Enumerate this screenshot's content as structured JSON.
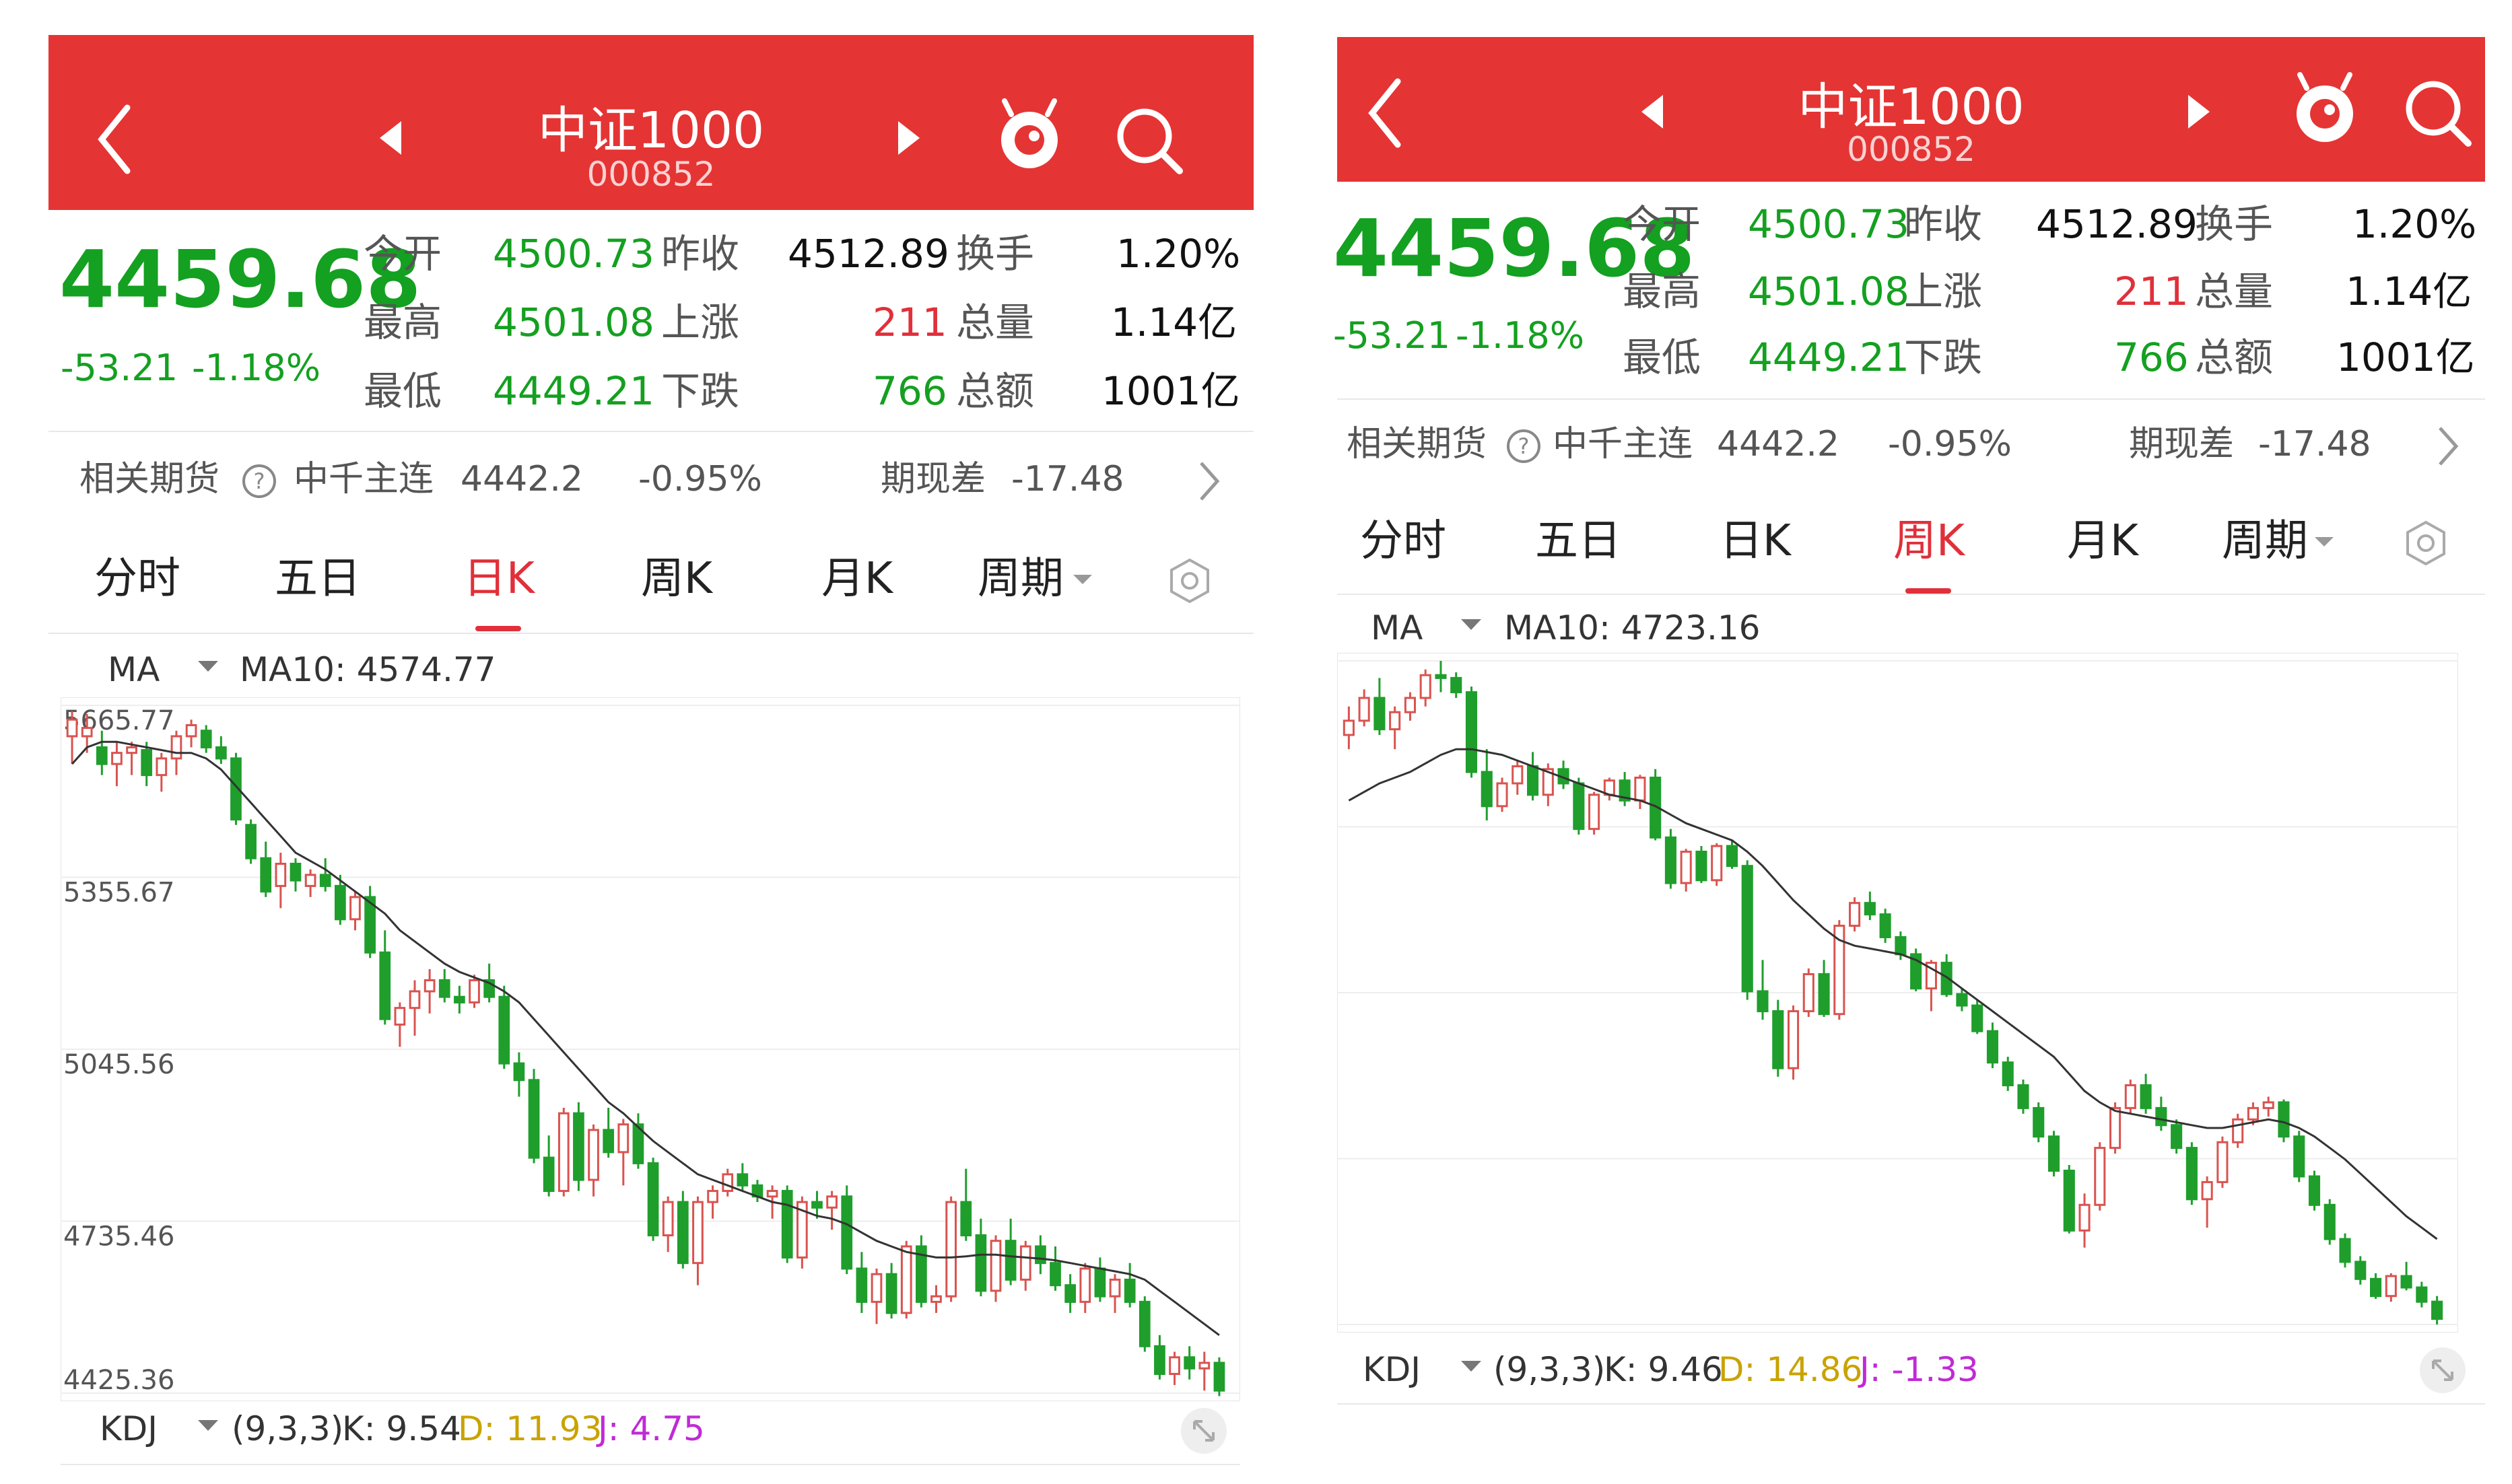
{
  "panels": [
    {
      "header": {
        "title": "中证1000",
        "code": "000852"
      },
      "quote": {
        "price": "4459.68",
        "change": "-53.21",
        "change_pct": "-1.18%",
        "open_label": "今开",
        "open": "4500.73",
        "prev_close_label": "昨收",
        "prev_close": "4512.89",
        "turnover_label": "换手",
        "turnover": "1.20%",
        "high_label": "最高",
        "high": "4501.08",
        "up_label": "上涨",
        "up": "211",
        "volume_label": "总量",
        "volume": "1.14亿",
        "low_label": "最低",
        "low": "4449.21",
        "down_label": "下跌",
        "down": "766",
        "amount_label": "总额",
        "amount": "1001亿"
      },
      "futures": {
        "label": "相关期货",
        "contract": "中千主连",
        "price": "4442.2",
        "pct": "-0.95%",
        "basis_label": "期现差",
        "basis": "-17.48"
      },
      "tabs": [
        "分时",
        "五日",
        "日K",
        "周K",
        "月K",
        "周期"
      ],
      "active_tab": 2,
      "ma": {
        "label": "MA",
        "value": "MA10: 4574.77"
      },
      "kdj": {
        "label": "KDJ",
        "params": "(9,3,3)",
        "k": "K: 9.54",
        "d": "D: 11.93",
        "j": "J: 4.75"
      }
    },
    {
      "header": {
        "title": "中证1000",
        "code": "000852"
      },
      "quote": {
        "price": "4459.68",
        "change": "-53.21",
        "change_pct": "-1.18%",
        "open_label": "今开",
        "open": "4500.73",
        "prev_close_label": "昨收",
        "prev_close": "4512.89",
        "turnover_label": "换手",
        "turnover": "1.20%",
        "high_label": "最高",
        "high": "4501.08",
        "up_label": "上涨",
        "up": "211",
        "volume_label": "总量",
        "volume": "1.14亿",
        "low_label": "最低",
        "low": "4449.21",
        "down_label": "下跌",
        "down": "766",
        "amount_label": "总额",
        "amount": "1001亿"
      },
      "futures": {
        "label": "相关期货",
        "contract": "中千主连",
        "price": "4442.2",
        "pct": "-0.95%",
        "basis_label": "期现差",
        "basis": "-17.48"
      },
      "tabs": [
        "分时",
        "五日",
        "日K",
        "周K",
        "月K",
        "周期"
      ],
      "active_tab": 3,
      "ma": {
        "label": "MA",
        "value": "MA10: 4723.16"
      },
      "kdj": {
        "label": "KDJ",
        "params": "(9,3,3)",
        "k": "K: 9.46",
        "d": "D: 14.86",
        "j": "J: -1.33"
      }
    }
  ],
  "chart_data": [
    {
      "type": "candlestick",
      "period": "日K",
      "y_tick_labels": [
        "5665.77",
        "5355.67",
        "5045.56",
        "4735.46",
        "4425.36"
      ],
      "ylim": [
        4425.36,
        5665.77
      ],
      "series": [
        {
          "name": "MA10",
          "type": "line"
        }
      ],
      "candles": [
        [
          5610,
          5655,
          5560,
          5640
        ],
        [
          5610,
          5650,
          5580,
          5625
        ],
        [
          5590,
          5620,
          5540,
          5560
        ],
        [
          5560,
          5600,
          5520,
          5580
        ],
        [
          5580,
          5600,
          5540,
          5590
        ],
        [
          5585,
          5600,
          5520,
          5540
        ],
        [
          5540,
          5580,
          5510,
          5570
        ],
        [
          5570,
          5620,
          5540,
          5610
        ],
        [
          5610,
          5640,
          5590,
          5630
        ],
        [
          5620,
          5630,
          5580,
          5590
        ],
        [
          5590,
          5610,
          5560,
          5570
        ],
        [
          5570,
          5580,
          5450,
          5460
        ],
        [
          5450,
          5460,
          5380,
          5390
        ],
        [
          5390,
          5420,
          5320,
          5330
        ],
        [
          5340,
          5400,
          5300,
          5380
        ],
        [
          5380,
          5390,
          5330,
          5350
        ],
        [
          5340,
          5370,
          5320,
          5360
        ],
        [
          5360,
          5390,
          5330,
          5340
        ],
        [
          5340,
          5360,
          5270,
          5280
        ],
        [
          5280,
          5330,
          5260,
          5320
        ],
        [
          5320,
          5340,
          5210,
          5220
        ],
        [
          5220,
          5260,
          5090,
          5100
        ],
        [
          5090,
          5130,
          5050,
          5120
        ],
        [
          5120,
          5170,
          5070,
          5150
        ],
        [
          5150,
          5190,
          5110,
          5170
        ],
        [
          5170,
          5190,
          5130,
          5140
        ],
        [
          5140,
          5160,
          5110,
          5130
        ],
        [
          5130,
          5180,
          5120,
          5170
        ],
        [
          5170,
          5200,
          5130,
          5140
        ],
        [
          5140,
          5160,
          5010,
          5020
        ],
        [
          5020,
          5040,
          4960,
          4990
        ],
        [
          4990,
          5010,
          4840,
          4850
        ],
        [
          4850,
          4890,
          4780,
          4790
        ],
        [
          4790,
          4940,
          4780,
          4930
        ],
        [
          4930,
          4950,
          4790,
          4810
        ],
        [
          4810,
          4910,
          4780,
          4900
        ],
        [
          4900,
          4940,
          4850,
          4860
        ],
        [
          4860,
          4920,
          4800,
          4910
        ],
        [
          4910,
          4930,
          4830,
          4840
        ],
        [
          4840,
          4850,
          4700,
          4710
        ],
        [
          4710,
          4780,
          4680,
          4770
        ],
        [
          4770,
          4790,
          4650,
          4660
        ],
        [
          4660,
          4780,
          4620,
          4770
        ],
        [
          4770,
          4800,
          4740,
          4790
        ],
        [
          4790,
          4830,
          4780,
          4820
        ],
        [
          4820,
          4840,
          4790,
          4800
        ],
        [
          4800,
          4810,
          4770,
          4780
        ],
        [
          4780,
          4800,
          4740,
          4790
        ],
        [
          4790,
          4800,
          4660,
          4670
        ],
        [
          4670,
          4780,
          4650,
          4770
        ],
        [
          4770,
          4790,
          4740,
          4760
        ],
        [
          4760,
          4790,
          4720,
          4780
        ],
        [
          4780,
          4800,
          4640,
          4650
        ],
        [
          4650,
          4680,
          4570,
          4590
        ],
        [
          4590,
          4650,
          4550,
          4640
        ],
        [
          4640,
          4660,
          4560,
          4570
        ],
        [
          4570,
          4700,
          4560,
          4690
        ],
        [
          4690,
          4710,
          4580,
          4590
        ],
        [
          4590,
          4620,
          4570,
          4600
        ],
        [
          4600,
          4780,
          4590,
          4770
        ],
        [
          4770,
          4830,
          4700,
          4710
        ],
        [
          4710,
          4740,
          4600,
          4610
        ],
        [
          4610,
          4710,
          4590,
          4700
        ],
        [
          4700,
          4740,
          4620,
          4630
        ],
        [
          4630,
          4700,
          4610,
          4690
        ],
        [
          4690,
          4710,
          4640,
          4660
        ],
        [
          4660,
          4690,
          4610,
          4620
        ],
        [
          4620,
          4640,
          4570,
          4590
        ],
        [
          4590,
          4660,
          4570,
          4650
        ],
        [
          4650,
          4670,
          4590,
          4600
        ],
        [
          4600,
          4640,
          4570,
          4630
        ],
        [
          4630,
          4660,
          4580,
          4590
        ],
        [
          4590,
          4600,
          4500,
          4510
        ],
        [
          4510,
          4530,
          4450,
          4460
        ],
        [
          4460,
          4500,
          4440,
          4490
        ],
        [
          4490,
          4510,
          4450,
          4470
        ],
        [
          4470,
          4500,
          4430,
          4480
        ],
        [
          4480,
          4490,
          4420,
          4430
        ]
      ],
      "ma10": [
        5560,
        5590,
        5600,
        5600,
        5595,
        5590,
        5585,
        5580,
        5580,
        5570,
        5550,
        5520,
        5490,
        5460,
        5430,
        5400,
        5385,
        5370,
        5350,
        5330,
        5310,
        5290,
        5260,
        5240,
        5220,
        5200,
        5185,
        5175,
        5165,
        5150,
        5130,
        5100,
        5070,
        5040,
        5010,
        4980,
        4950,
        4930,
        4905,
        4880,
        4860,
        4840,
        4820,
        4810,
        4800,
        4790,
        4780,
        4770,
        4765,
        4755,
        4745,
        4740,
        4730,
        4715,
        4700,
        4690,
        4680,
        4675,
        4670,
        4670,
        4672,
        4675,
        4675,
        4672,
        4670,
        4668,
        4665,
        4660,
        4655,
        4650,
        4645,
        4640,
        4630,
        4610,
        4590,
        4570,
        4550,
        4530
      ]
    },
    {
      "type": "candlestick",
      "period": "周K",
      "series": [
        {
          "name": "MA10",
          "type": "line"
        }
      ],
      "candles": [
        [
          6850,
          6950,
          6800,
          6900
        ],
        [
          6900,
          7010,
          6880,
          6980
        ],
        [
          6980,
          7050,
          6850,
          6870
        ],
        [
          6870,
          6950,
          6800,
          6930
        ],
        [
          6930,
          7000,
          6900,
          6980
        ],
        [
          6980,
          7080,
          6950,
          7060
        ],
        [
          7060,
          7110,
          7000,
          7050
        ],
        [
          7050,
          7070,
          6980,
          7000
        ],
        [
          7000,
          7020,
          6700,
          6720
        ],
        [
          6720,
          6800,
          6550,
          6600
        ],
        [
          6600,
          6700,
          6580,
          6680
        ],
        [
          6680,
          6760,
          6640,
          6740
        ],
        [
          6740,
          6790,
          6620,
          6640
        ],
        [
          6640,
          6750,
          6600,
          6730
        ],
        [
          6730,
          6760,
          6660,
          6680
        ],
        [
          6680,
          6700,
          6500,
          6520
        ],
        [
          6520,
          6650,
          6500,
          6640
        ],
        [
          6640,
          6700,
          6620,
          6690
        ],
        [
          6690,
          6720,
          6600,
          6620
        ],
        [
          6620,
          6710,
          6590,
          6700
        ],
        [
          6700,
          6730,
          6480,
          6490
        ],
        [
          6490,
          6520,
          6310,
          6330
        ],
        [
          6330,
          6450,
          6300,
          6440
        ],
        [
          6440,
          6460,
          6330,
          6340
        ],
        [
          6340,
          6470,
          6320,
          6460
        ],
        [
          6460,
          6480,
          6380,
          6390
        ],
        [
          6390,
          6410,
          5920,
          5950
        ],
        [
          5950,
          6060,
          5850,
          5880
        ],
        [
          5880,
          5920,
          5650,
          5680
        ],
        [
          5680,
          5900,
          5640,
          5880
        ],
        [
          5880,
          6030,
          5860,
          6010
        ],
        [
          6010,
          6060,
          5860,
          5870
        ],
        [
          5870,
          6200,
          5850,
          6180
        ],
        [
          6180,
          6280,
          6160,
          6260
        ],
        [
          6260,
          6300,
          6200,
          6220
        ],
        [
          6220,
          6240,
          6120,
          6140
        ],
        [
          6140,
          6160,
          6060,
          6080
        ],
        [
          6080,
          6100,
          5950,
          5960
        ],
        [
          5960,
          6060,
          5880,
          6050
        ],
        [
          6050,
          6080,
          5930,
          5940
        ],
        [
          5940,
          5960,
          5880,
          5900
        ],
        [
          5900,
          5920,
          5800,
          5810
        ],
        [
          5810,
          5840,
          5680,
          5700
        ],
        [
          5700,
          5720,
          5600,
          5620
        ],
        [
          5620,
          5640,
          5520,
          5540
        ],
        [
          5540,
          5560,
          5420,
          5440
        ],
        [
          5440,
          5460,
          5300,
          5320
        ],
        [
          5320,
          5340,
          5100,
          5110
        ],
        [
          5110,
          5240,
          5050,
          5200
        ],
        [
          5200,
          5420,
          5180,
          5400
        ],
        [
          5400,
          5560,
          5380,
          5540
        ],
        [
          5540,
          5640,
          5520,
          5620
        ],
        [
          5620,
          5660,
          5520,
          5540
        ],
        [
          5540,
          5580,
          5460,
          5480
        ],
        [
          5480,
          5500,
          5380,
          5400
        ],
        [
          5400,
          5420,
          5200,
          5220
        ],
        [
          5220,
          5300,
          5120,
          5280
        ],
        [
          5280,
          5440,
          5260,
          5420
        ],
        [
          5420,
          5520,
          5400,
          5500
        ],
        [
          5500,
          5560,
          5480,
          5540
        ],
        [
          5540,
          5580,
          5510,
          5560
        ],
        [
          5560,
          5570,
          5420,
          5440
        ],
        [
          5440,
          5460,
          5280,
          5300
        ],
        [
          5300,
          5320,
          5180,
          5200
        ],
        [
          5200,
          5220,
          5060,
          5080
        ],
        [
          5080,
          5100,
          4980,
          5000
        ],
        [
          5000,
          5020,
          4920,
          4940
        ],
        [
          4940,
          4960,
          4870,
          4880
        ],
        [
          4880,
          4960,
          4860,
          4950
        ],
        [
          4950,
          5000,
          4900,
          4910
        ],
        [
          4910,
          4930,
          4840,
          4860
        ],
        [
          4860,
          4880,
          4780,
          4800
        ]
      ],
      "ma10": [
        6620,
        6650,
        6680,
        6700,
        6720,
        6750,
        6780,
        6800,
        6800,
        6790,
        6780,
        6760,
        6740,
        6720,
        6700,
        6680,
        6660,
        6640,
        6630,
        6620,
        6600,
        6570,
        6540,
        6520,
        6500,
        6480,
        6440,
        6390,
        6330,
        6270,
        6220,
        6170,
        6130,
        6110,
        6100,
        6090,
        6080,
        6060,
        6030,
        6000,
        5960,
        5920,
        5880,
        5840,
        5800,
        5760,
        5720,
        5660,
        5600,
        5560,
        5530,
        5520,
        5510,
        5500,
        5490,
        5480,
        5470,
        5470,
        5480,
        5490,
        5500,
        5490,
        5470,
        5440,
        5400,
        5360,
        5310,
        5260,
        5210,
        5160,
        5120,
        5080
      ]
    }
  ]
}
